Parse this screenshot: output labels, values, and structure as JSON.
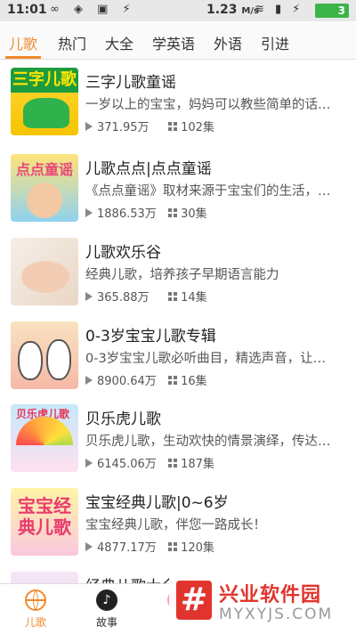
{
  "status_bar": {
    "time": "11:01",
    "network_speed": "1.23",
    "network_unit": "M/s",
    "battery": "3",
    "left_icons": "∞ ◈ ▣ ⚡",
    "right_icons": "≋ ▮ ⚡"
  },
  "tabs": [
    {
      "label": "儿歌",
      "active": true
    },
    {
      "label": "热门",
      "active": false
    },
    {
      "label": "大全",
      "active": false
    },
    {
      "label": "学英语",
      "active": false
    },
    {
      "label": "外语",
      "active": false
    },
    {
      "label": "引进",
      "active": false
    }
  ],
  "items": [
    {
      "title": "三字儿歌童谣",
      "desc": "一岁以上的宝宝，妈妈可以教些简单的话…",
      "plays": "371.95万",
      "episodes": "102集",
      "thumb_label": "三字儿歌"
    },
    {
      "title": "儿歌点点|点点童谣",
      "desc": "《点点童谣》取材来源于宝宝们的生活，…",
      "plays": "1886.53万",
      "episodes": "30集",
      "thumb_label": "点点童谣"
    },
    {
      "title": "儿歌欢乐谷",
      "desc": "经典儿歌，培养孩子早期语言能力",
      "plays": "365.88万",
      "episodes": "14集"
    },
    {
      "title": "0-3岁宝宝儿歌专辑",
      "desc": "0-3岁宝宝儿歌必听曲目，精选声音，让…",
      "plays": "8900.64万",
      "episodes": "16集"
    },
    {
      "title": "贝乐虎儿歌",
      "desc": "贝乐虎儿歌，生动欢快的情景演绎，传达…",
      "plays": "6145.06万",
      "episodes": "187集",
      "thumb_label": "贝乐虎儿歌"
    },
    {
      "title": "宝宝经典儿歌|0~6岁",
      "desc": "宝宝经典儿歌，伴您一路成长！",
      "plays": "4877.17万",
      "episodes": "120集",
      "thumb_label": "宝宝经典儿歌"
    },
    {
      "title": "经典儿歌大全"
    }
  ],
  "bottom_nav": [
    {
      "label": "儿歌",
      "icon": "globe-icon",
      "active": true
    },
    {
      "label": "故事",
      "icon": "music-icon",
      "active": false
    },
    {
      "label": "",
      "icon": "third-icon",
      "active": false
    }
  ],
  "watermark": {
    "logo": "#",
    "cn": "兴业软件园",
    "en": "MYXYJS.COM"
  },
  "colors": {
    "accent": "#f08a2c",
    "watermark": "#e2342e"
  }
}
